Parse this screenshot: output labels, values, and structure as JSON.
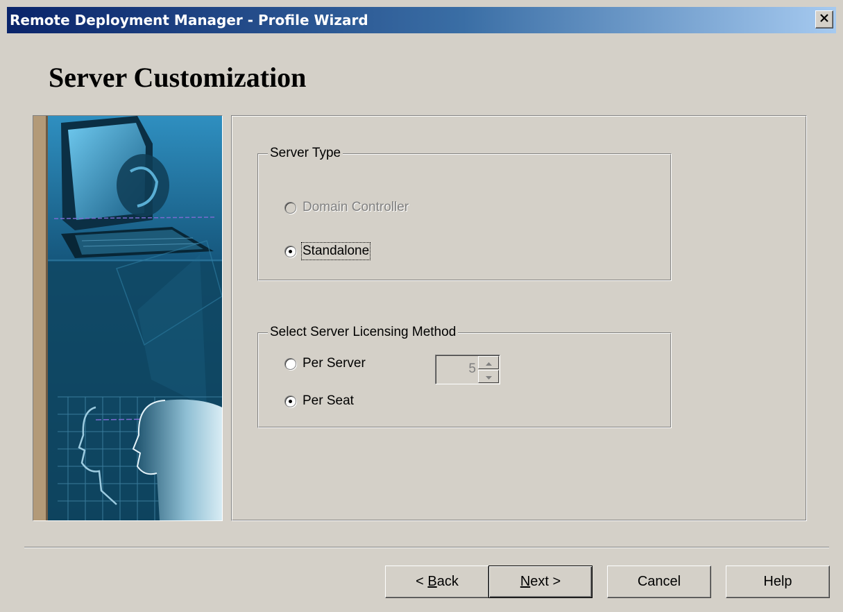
{
  "window": {
    "title": "Remote Deployment Manager - Profile Wizard"
  },
  "page": {
    "title": "Server Customization"
  },
  "server_type": {
    "legend": "Server Type",
    "options": [
      {
        "label": "Domain Controller",
        "selected": false,
        "enabled": false
      },
      {
        "label": "Standalone",
        "selected": true,
        "enabled": true
      }
    ]
  },
  "licensing": {
    "legend": "Select Server Licensing Method",
    "options": [
      {
        "label": "Per Server",
        "selected": false,
        "enabled": true
      },
      {
        "label": "Per Seat",
        "selected": true,
        "enabled": true
      }
    ],
    "connections_value": "5"
  },
  "buttons": {
    "back": {
      "prefix": "< ",
      "mnemonic": "B",
      "rest": "ack"
    },
    "next": {
      "mnemonic": "N",
      "rest": "ext >"
    },
    "cancel": "Cancel",
    "help": "Help"
  },
  "icons": {
    "close": "close-icon",
    "spin_up": "arrow-up-icon",
    "spin_down": "arrow-down-icon"
  },
  "colors": {
    "titlebar_start": "#0a246a",
    "titlebar_end": "#a6caf0",
    "face": "#d4d0c8"
  }
}
